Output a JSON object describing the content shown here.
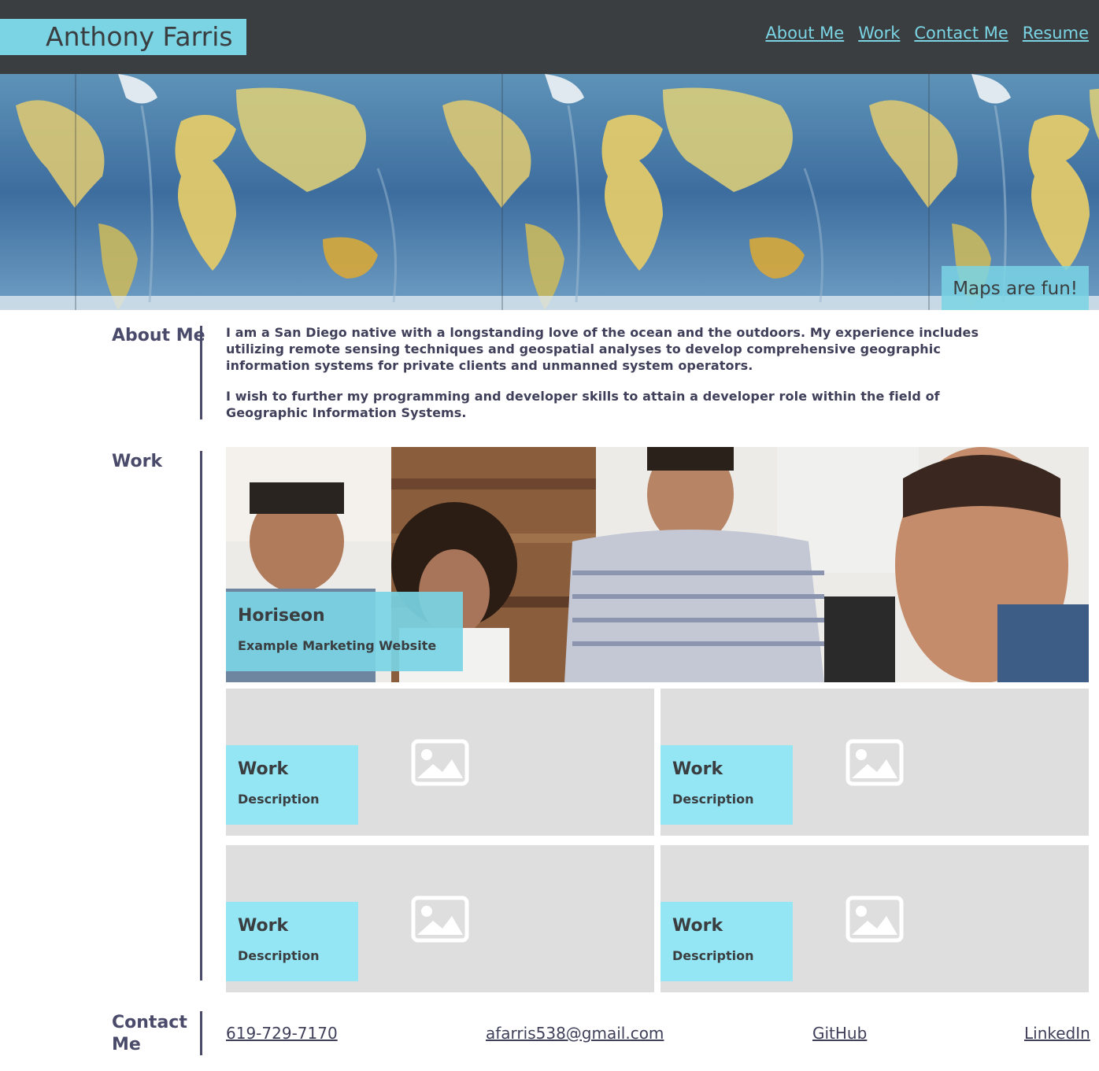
{
  "header": {
    "brand": "Anthony Farris",
    "nav": [
      "About Me",
      "Work",
      "Contact Me",
      "Resume"
    ]
  },
  "hero": {
    "caption": "Maps are fun!"
  },
  "about": {
    "heading": "About Me",
    "paragraphs": [
      "I am a San Diego native with a longstanding love of the ocean and the outdoors. My experience includes utilizing remote sensing techniques and geospatial analyses to develop comprehensive geographic information systems for private clients and unmanned system operators.",
      "I wish to further my programming and developer skills to attain a developer role within the field of Geographic Information Systems."
    ]
  },
  "work": {
    "heading": "Work",
    "featured": {
      "title": "Horiseon",
      "description": "Example Marketing Website"
    },
    "tiles": [
      {
        "title": "Work",
        "description": "Description",
        "icon": "image-placeholder-icon"
      },
      {
        "title": "Work",
        "description": "Description",
        "icon": "image-placeholder-icon"
      },
      {
        "title": "Work",
        "description": "Description",
        "icon": "image-placeholder-icon"
      },
      {
        "title": "Work",
        "description": "Description",
        "icon": "image-placeholder-icon"
      }
    ]
  },
  "contact": {
    "heading": "Contact Me",
    "heading_lines": [
      "Contact",
      "Me"
    ],
    "phone": "619-729-7170",
    "email": "afarris538@gmail.com",
    "github": "GitHub",
    "linkedin": "LinkedIn"
  },
  "colors": {
    "header_bg": "#3a3e40",
    "accent": "#7ad4e4",
    "tile_label": "#94e6f5",
    "text": "#3f3f5a"
  }
}
